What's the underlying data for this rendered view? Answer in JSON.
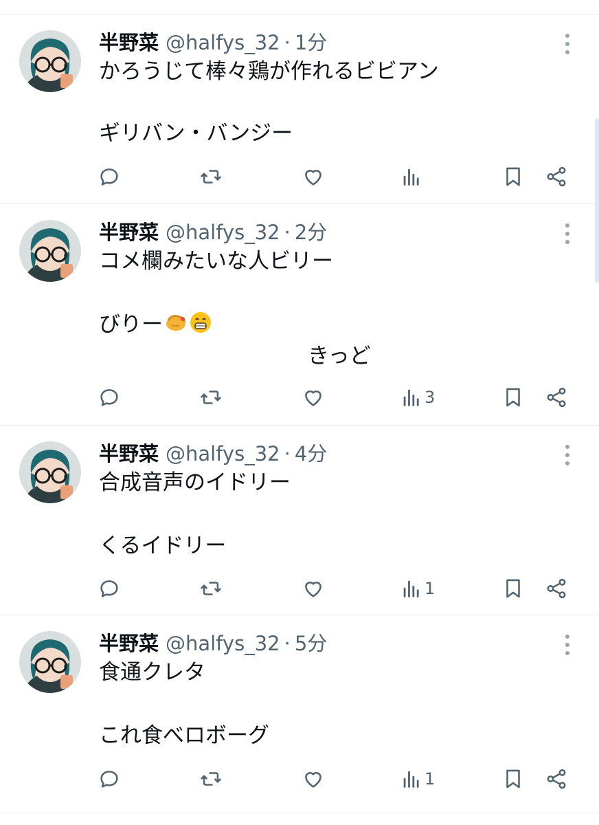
{
  "tweets": [
    {
      "author": "半野菜",
      "handle": "@halfys_32",
      "separator": "·",
      "time": "1分",
      "lines": [
        "かろうじて棒々鶏が作れるビビアン",
        "ギリバン・バンジー"
      ],
      "views": ""
    },
    {
      "author": "半野菜",
      "handle": "@halfys_32",
      "separator": "·",
      "time": "2分",
      "lines": [
        "コメ欄みたいな人ビリー",
        "びりー",
        "きっど"
      ],
      "emojis": [
        "pinching-hand-emoji",
        "grinning-face-emoji"
      ],
      "views": "3"
    },
    {
      "author": "半野菜",
      "handle": "@halfys_32",
      "separator": "·",
      "time": "4分",
      "lines": [
        "合成音声のイドリー",
        "くるイドリー"
      ],
      "views": "1"
    },
    {
      "author": "半野菜",
      "handle": "@halfys_32",
      "separator": "·",
      "time": "5分",
      "lines": [
        "食通クレタ",
        "これ食べロボーグ"
      ],
      "views": "1"
    }
  ],
  "actions": [
    "reply-icon",
    "retweet-icon",
    "like-icon",
    "views-icon",
    "bookmark-icon",
    "share-icon"
  ],
  "colors": {
    "text": "#0f1419",
    "secondary": "#536471",
    "divider": "#e6e9ec",
    "scrollbar": "#dbeaf7"
  }
}
